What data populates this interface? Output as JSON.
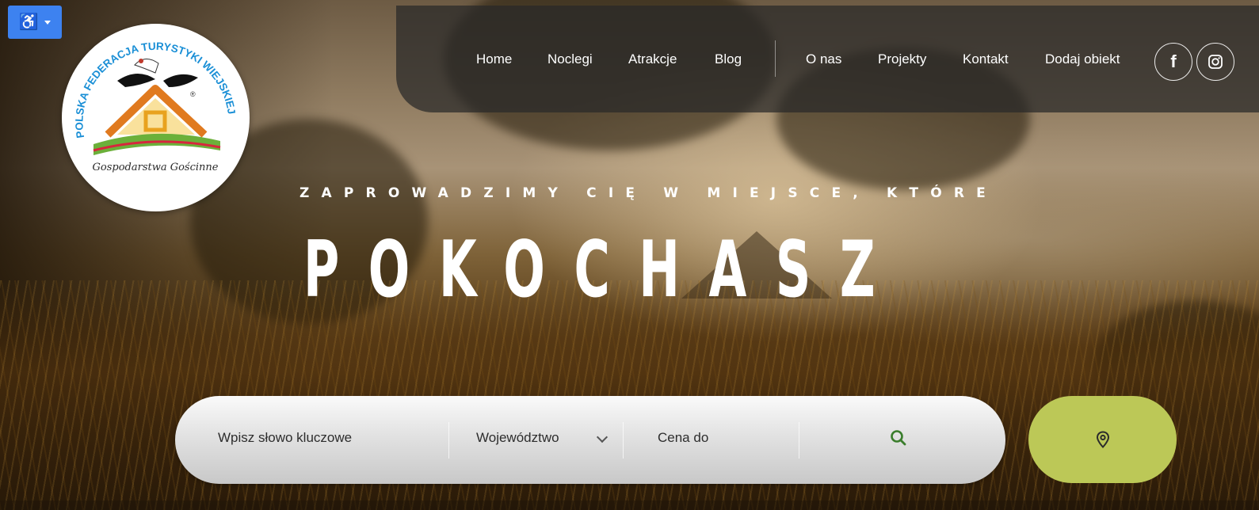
{
  "accessibility": {
    "icon": "wheelchair-icon",
    "glyph": "♿"
  },
  "logo": {
    "name": "Polska Federacja Turystyki Wiejskiej – Gospodarstwa Gościnne",
    "ring_text": "POLSKA FEDERACJA TURYSTYKI WIEJSKIEJ",
    "script_text": "Gospodarstwa Gościnne",
    "registered": "®"
  },
  "nav": {
    "items": [
      {
        "label": "Home"
      },
      {
        "label": "Noclegi"
      },
      {
        "label": "Atrakcje"
      },
      {
        "label": "Blog"
      },
      {
        "label": "O nas"
      },
      {
        "label": "Projekty"
      },
      {
        "label": "Kontakt"
      },
      {
        "label": "Dodaj obiekt"
      }
    ],
    "social": [
      {
        "icon": "facebook-icon",
        "glyph": "f"
      },
      {
        "icon": "instagram-icon"
      }
    ]
  },
  "hero": {
    "tagline": "ZAPROWADZIMY CIĘ W MIEJSCE, KTÓRE",
    "headline": "POKOCHASZ"
  },
  "search": {
    "keyword_placeholder": "Wpisz słowo kluczowe",
    "region_label": "Województwo",
    "price_label": "Cena do",
    "search_icon": "search-icon",
    "map_icon": "map-pin-icon"
  },
  "colors": {
    "accessibility_blue": "#3d82f0",
    "map_button_green": "#bcc857",
    "search_icon_green": "#3a7d2c",
    "nav_bg": "rgba(40,40,40,0.72)"
  }
}
